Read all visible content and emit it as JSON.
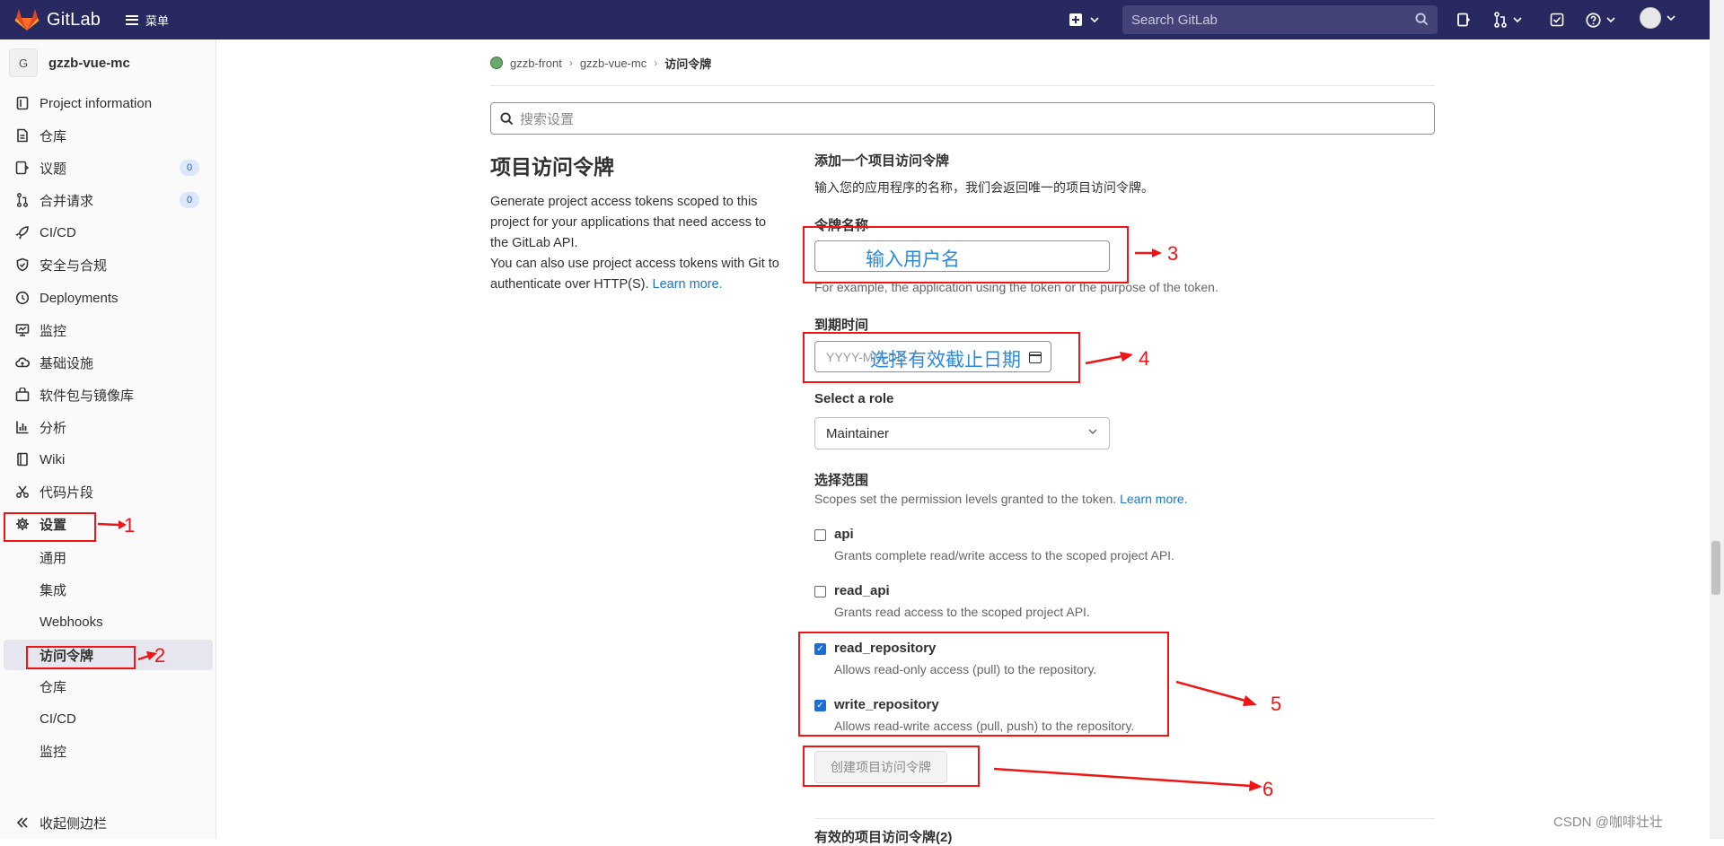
{
  "navbar": {
    "brand": "GitLab",
    "menu_label": "菜单",
    "search_placeholder": "Search GitLab"
  },
  "sidebar": {
    "project_initial": "G",
    "project_name": "gzzb-vue-mc",
    "items": [
      {
        "label": "Project information",
        "icon": "info-icon"
      },
      {
        "label": "仓库",
        "icon": "doc-icon"
      },
      {
        "label": "议题",
        "icon": "issues-icon",
        "badge": "0"
      },
      {
        "label": "合并请求",
        "icon": "merge-request-icon",
        "badge": "0"
      },
      {
        "label": "CI/CD",
        "icon": "rocket-icon"
      },
      {
        "label": "安全与合规",
        "icon": "shield-icon"
      },
      {
        "label": "Deployments",
        "icon": "deployments-icon"
      },
      {
        "label": "监控",
        "icon": "monitor-icon"
      },
      {
        "label": "基础设施",
        "icon": "cloud-icon"
      },
      {
        "label": "软件包与镜像库",
        "icon": "package-icon"
      },
      {
        "label": "分析",
        "icon": "chart-icon"
      },
      {
        "label": "Wiki",
        "icon": "book-icon"
      },
      {
        "label": "代码片段",
        "icon": "snippet-icon"
      },
      {
        "label": "设置",
        "icon": "gear-icon"
      }
    ],
    "settings_sub": [
      "通用",
      "集成",
      "Webhooks",
      "访问令牌",
      "仓库",
      "CI/CD",
      "监控"
    ],
    "collapse_label": "收起侧边栏"
  },
  "breadcrumb": {
    "group": "gzzb-front",
    "project": "gzzb-vue-mc",
    "current": "访问令牌"
  },
  "settings_search_placeholder": "搜索设置",
  "section": {
    "title": "项目访问令牌",
    "desc_1": "Generate project access tokens scoped to this project for your applications that need access to the GitLab API.",
    "desc_2": "You can also use project access tokens with Git to authenticate over HTTP(S).",
    "learn_more": "Learn more."
  },
  "form": {
    "title": "添加一个项目访问令牌",
    "subtitle": "输入您的应用程序的名称，我们会返回唯一的项目访问令牌。",
    "name_label": "令牌名称",
    "name_help": "For example, the application using the token or the purpose of the token.",
    "expiry_label": "到期时间",
    "expiry_placeholder": "YYYY-MM-DD",
    "role_label": "Select a role",
    "role_value": "Maintainer",
    "scopes_label": "选择范围",
    "scopes_help": "Scopes set the permission levels granted to the token.",
    "scopes_learn_more": "Learn more.",
    "scopes": [
      {
        "name": "api",
        "help": "Grants complete read/write access to the scoped project API.",
        "checked": false
      },
      {
        "name": "read_api",
        "help": "Grants read access to the scoped project API.",
        "checked": false
      },
      {
        "name": "read_repository",
        "help": "Allows read-only access (pull) to the repository.",
        "checked": true
      },
      {
        "name": "write_repository",
        "help": "Allows read-write access (pull, push) to the repository.",
        "checked": true
      }
    ],
    "create_button": "创建项目访问令牌",
    "active_tokens": "有效的项目访问令牌(2)"
  },
  "annotations": {
    "n1": "1",
    "n2": "2",
    "n3": "3",
    "n4": "4",
    "n5": "5",
    "n6": "6",
    "name_note": "输入用户名",
    "date_note": "选择有效截止日期"
  },
  "watermark": "CSDN @咖啡壮壮",
  "colors": {
    "navbar": "#292961",
    "annotation": "#f01414",
    "link": "#1f75cb"
  }
}
